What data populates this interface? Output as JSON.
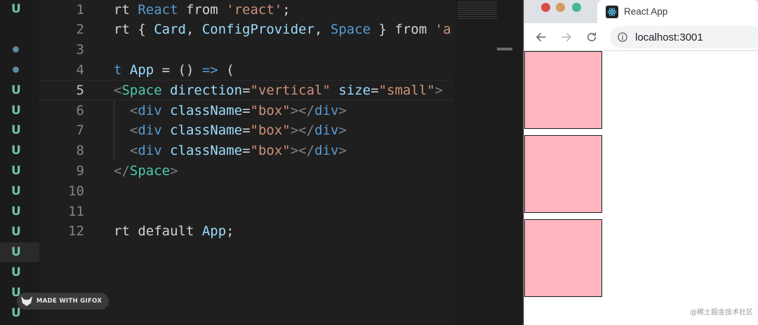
{
  "editor": {
    "gutter_marks": [
      {
        "type": "letter",
        "text": "U"
      },
      {
        "type": "empty",
        "text": ""
      },
      {
        "type": "dot",
        "text": ""
      },
      {
        "type": "dot",
        "text": ""
      },
      {
        "type": "letter",
        "text": "U"
      },
      {
        "type": "letter",
        "text": "U"
      },
      {
        "type": "letter",
        "text": "U"
      },
      {
        "type": "letter",
        "text": "U"
      },
      {
        "type": "letter",
        "text": "U"
      },
      {
        "type": "letter",
        "text": "U"
      },
      {
        "type": "letter",
        "text": "U"
      },
      {
        "type": "letter",
        "text": "U"
      },
      {
        "type": "letter",
        "text": "U"
      },
      {
        "type": "letter",
        "text": "U"
      },
      {
        "type": "letter",
        "text": "U"
      },
      {
        "type": "letter",
        "text": "U"
      }
    ],
    "active_line": 5,
    "lines": [
      {
        "num": "1",
        "tokens": [
          [
            "plain",
            "rt "
          ],
          [
            "kw",
            "React"
          ],
          [
            "plain",
            " from "
          ],
          [
            "str",
            "'react'"
          ],
          [
            "plain",
            ";"
          ]
        ]
      },
      {
        "num": "2",
        "tokens": [
          [
            "plain",
            "rt { "
          ],
          [
            "id",
            "Card"
          ],
          [
            "plain",
            ", "
          ],
          [
            "id",
            "ConfigProvider"
          ],
          [
            "plain",
            ", "
          ],
          [
            "kw",
            "Space"
          ],
          [
            "plain",
            " } from "
          ],
          [
            "str",
            "'a"
          ]
        ]
      },
      {
        "num": "3",
        "tokens": []
      },
      {
        "num": "4",
        "tokens": [
          [
            "kw",
            "t "
          ],
          [
            "id",
            "App"
          ],
          [
            "plain",
            " = () "
          ],
          [
            "kw",
            "=>"
          ],
          [
            "plain",
            " ("
          ]
        ]
      },
      {
        "num": "5",
        "tokens": [
          [
            "brk",
            "<"
          ],
          [
            "tag",
            "Space"
          ],
          [
            "plain",
            " "
          ],
          [
            "attr",
            "direction"
          ],
          [
            "plain",
            "="
          ],
          [
            "str",
            "\"vertical\""
          ],
          [
            "plain",
            " "
          ],
          [
            "attr",
            "size"
          ],
          [
            "plain",
            "="
          ],
          [
            "str",
            "\"small\""
          ],
          [
            "brk",
            ">"
          ]
        ]
      },
      {
        "num": "6",
        "tokens": [
          [
            "plain",
            "  "
          ],
          [
            "brk",
            "<"
          ],
          [
            "kw",
            "div"
          ],
          [
            "plain",
            " "
          ],
          [
            "attr",
            "className"
          ],
          [
            "plain",
            "="
          ],
          [
            "str",
            "\"box\""
          ],
          [
            "brk",
            "></"
          ],
          [
            "kw",
            "div"
          ],
          [
            "brk",
            ">"
          ]
        ]
      },
      {
        "num": "7",
        "tokens": [
          [
            "plain",
            "  "
          ],
          [
            "brk",
            "<"
          ],
          [
            "kw",
            "div"
          ],
          [
            "plain",
            " "
          ],
          [
            "attr",
            "className"
          ],
          [
            "plain",
            "="
          ],
          [
            "str",
            "\"box\""
          ],
          [
            "brk",
            "></"
          ],
          [
            "kw",
            "div"
          ],
          [
            "brk",
            ">"
          ]
        ]
      },
      {
        "num": "8",
        "tokens": [
          [
            "plain",
            "  "
          ],
          [
            "brk",
            "<"
          ],
          [
            "kw",
            "div"
          ],
          [
            "plain",
            " "
          ],
          [
            "attr",
            "className"
          ],
          [
            "plain",
            "="
          ],
          [
            "str",
            "\"box\""
          ],
          [
            "brk",
            "></"
          ],
          [
            "kw",
            "div"
          ],
          [
            "brk",
            ">"
          ]
        ]
      },
      {
        "num": "9",
        "tokens": [
          [
            "brk",
            "</"
          ],
          [
            "tag",
            "Space"
          ],
          [
            "brk",
            ">"
          ]
        ]
      },
      {
        "num": "10",
        "tokens": []
      },
      {
        "num": "11",
        "tokens": []
      },
      {
        "num": "12",
        "tokens": [
          [
            "plain",
            "rt default "
          ],
          [
            "id",
            "App"
          ],
          [
            "plain",
            ";"
          ]
        ]
      }
    ]
  },
  "gifox_badge": "MADE WITH GIFOX",
  "browser": {
    "tab_title": "React App",
    "url": "localhost:3001",
    "boxes": 3,
    "box_color": "#ffb6c1",
    "watermark": "@稀土掘金技术社区"
  },
  "colors": {
    "traffic_red": "#d94f47",
    "traffic_yellow": "#d59b5f",
    "traffic_green": "#47b59a"
  }
}
